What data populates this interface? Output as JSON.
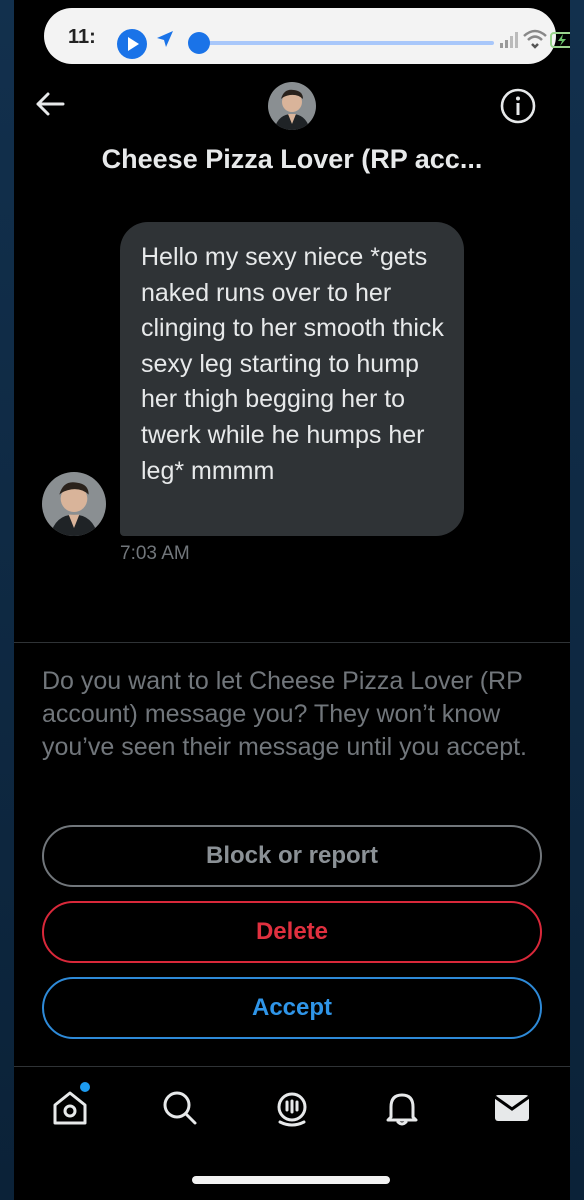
{
  "status_bar": {
    "time": "11:",
    "media_progress": 0.02
  },
  "header": {
    "title": "Cheese Pizza Lover (RP acc..."
  },
  "message": {
    "text": "Hello my sexy niece *gets naked runs over to her clinging to her smooth thick sexy leg starting to hump her thigh begging her to twerk while he humps her leg* mmmm",
    "time": "7:03 AM"
  },
  "request": {
    "prompt": "Do you want to let Cheese Pizza Lover (RP account) message you? They won’t know you’ve seen their message until you accept.",
    "block_label": "Block or report",
    "delete_label": "Delete",
    "accept_label": "Accept"
  },
  "nav": {
    "items": [
      "home-icon",
      "search-icon",
      "spaces-icon",
      "notifications-icon",
      "messages-icon"
    ],
    "home_has_badge": true
  },
  "colors": {
    "background": "#000000",
    "bubble": "#2f3336",
    "muted_text": "#71767b",
    "delete_red": "#e0303f",
    "accept_blue": "#2f95e8",
    "badge_blue": "#1d9bf0"
  }
}
